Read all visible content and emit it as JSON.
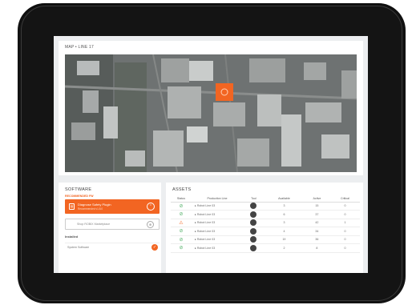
{
  "map": {
    "title": "MAP • LINE 17"
  },
  "software": {
    "title": "SOFTWARE",
    "recommended_label": "RECOMMENDED FW",
    "recommended": {
      "name": "Diagnose Safety Plugin",
      "sub": "Recommended v1.8.0"
    },
    "shop_placeholder": "Shop ROBIX Marketplace",
    "installed_label": "Installed",
    "installed_items": [
      "System Software"
    ]
  },
  "assets": {
    "title": "ASSETS",
    "columns": [
      "Status",
      "Production Line",
      "Tool",
      "Available",
      "Active",
      "Critical"
    ],
    "rows": [
      {
        "status": "ok",
        "line": "Robot Line 03",
        "available": "3",
        "active": "15",
        "critical": "0"
      },
      {
        "status": "ok",
        "line": "Robot Line 03",
        "available": "6",
        "active": "37",
        "critical": "0"
      },
      {
        "status": "warn",
        "line": "Robot Line 03",
        "available": "3",
        "active": "42",
        "critical": "1"
      },
      {
        "status": "ok",
        "line": "Robot Line 03",
        "available": "4",
        "active": "34",
        "critical": "0"
      },
      {
        "status": "ok",
        "line": "Robot Line 03",
        "available": "19",
        "active": "36",
        "critical": "0"
      },
      {
        "status": "ok",
        "line": "Robot Line 03",
        "available": "2",
        "active": "8",
        "critical": "0"
      }
    ]
  },
  "icons": {
    "ok": "check-circle-icon",
    "warn": "warning-triangle-icon"
  },
  "colors": {
    "accent": "#f26522",
    "ok": "#57b26c",
    "teal": "#3fa6a3"
  }
}
